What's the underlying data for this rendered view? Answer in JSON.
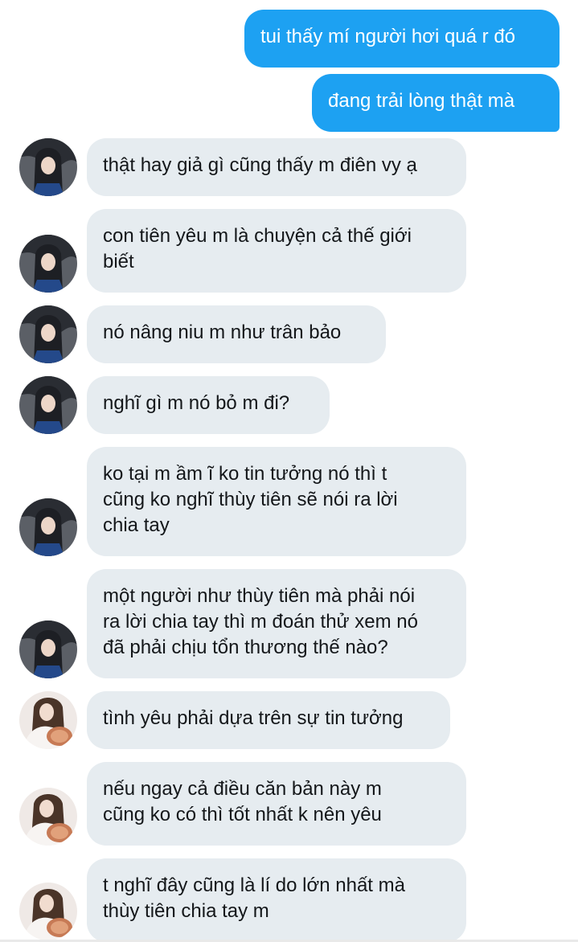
{
  "chat": {
    "messages": [
      {
        "id": "m1",
        "side": "out",
        "text": "tui thấy mí người hơi quá r đó"
      },
      {
        "id": "m2",
        "side": "out",
        "text": "đang trải lòng thật mà"
      },
      {
        "id": "m3",
        "side": "in",
        "avatar": "user-a",
        "text": "thật hay giả gì cũng thấy m điên vy ạ"
      },
      {
        "id": "m4",
        "side": "in",
        "avatar": "user-a",
        "text": "con tiên yêu m là chuyện cả thế giới\nbiết"
      },
      {
        "id": "m5",
        "side": "in",
        "avatar": "user-a",
        "text": "nó nâng niu m như trân bảo"
      },
      {
        "id": "m6",
        "side": "in",
        "avatar": "user-a",
        "text": "nghĩ gì m nó bỏ m đi?"
      },
      {
        "id": "m7",
        "side": "in",
        "avatar": "user-a",
        "text": "ko tại m ầm ĩ ko tin tưởng nó thì t\ncũng ko nghĩ thùy tiên sẽ nói ra lời\nchia tay"
      },
      {
        "id": "m8",
        "side": "in",
        "avatar": "user-a",
        "text": "một người như thùy tiên mà phải nói\nra lời chia tay thì m đoán thử xem nó\nđã phải chịu tổn thương thế nào?"
      },
      {
        "id": "m9",
        "side": "in",
        "avatar": "user-b",
        "text": "tình yêu phải dựa trên sự tin tưởng"
      },
      {
        "id": "m10",
        "side": "in",
        "avatar": "user-b",
        "text": "nếu ngay cả điều căn bản này m\ncũng ko có thì tốt nhất k nên yêu"
      },
      {
        "id": "m11",
        "side": "in",
        "avatar": "user-b",
        "text": "t nghĩ đây cũng là lí do lớn nhất mà\nthùy tiên chia tay m"
      }
    ]
  },
  "colors": {
    "outgoing_bubble": "#1DA1F2",
    "incoming_bubble": "#E6ECF0",
    "outgoing_text": "#FFFFFF",
    "incoming_text": "#14171A"
  }
}
